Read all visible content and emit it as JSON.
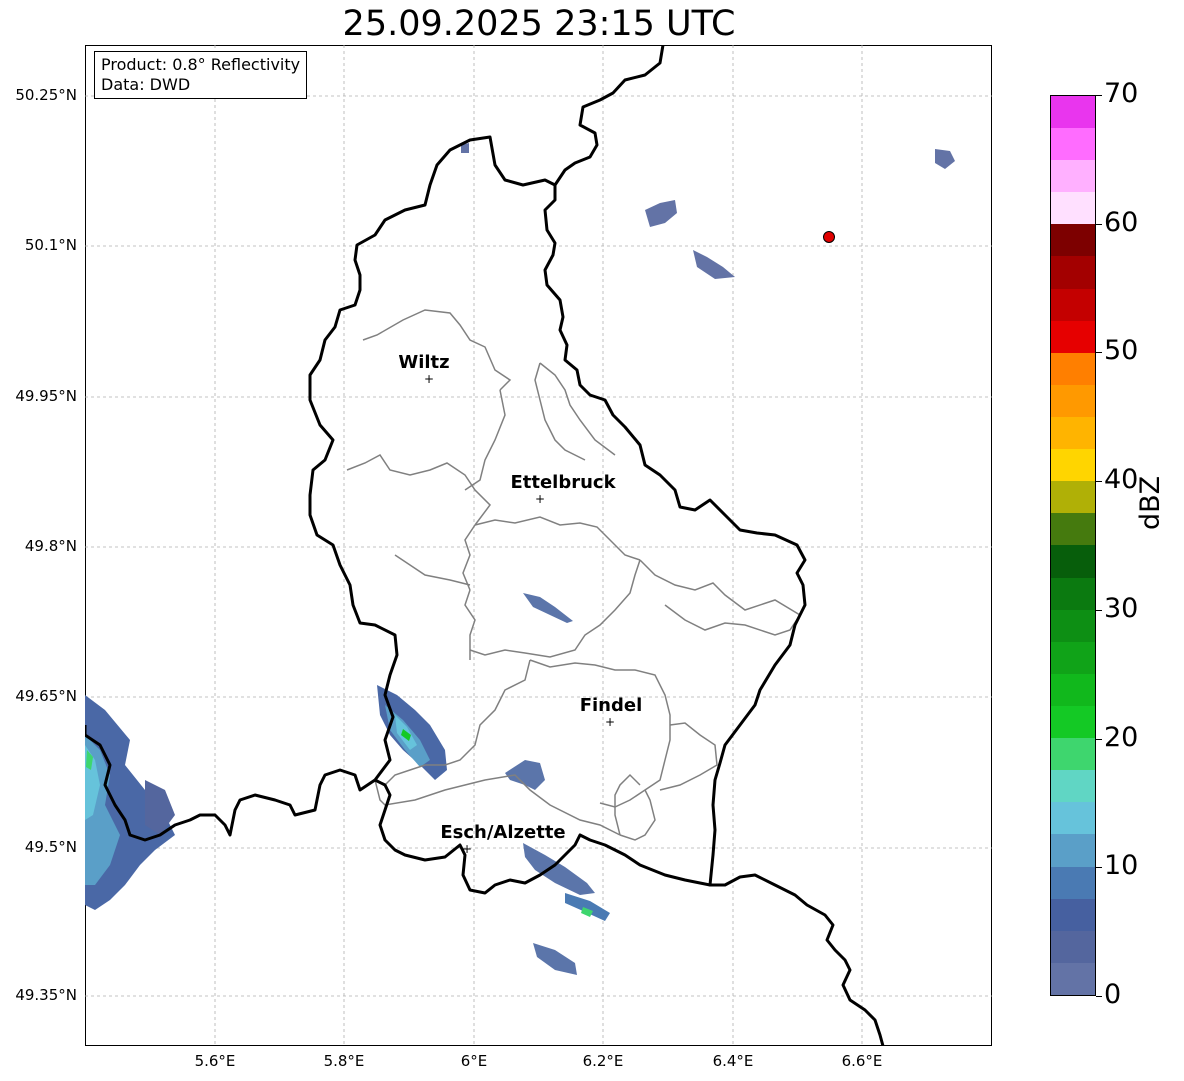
{
  "title": "25.09.2025 23:15 UTC",
  "info": {
    "product": "Product: 0.8° Reflectivity",
    "source": "Data: DWD"
  },
  "axes": {
    "lon_ticks": [
      "5.6°E",
      "5.8°E",
      "6°E",
      "6.2°E",
      "6.4°E",
      "6.6°E"
    ],
    "lat_ticks": [
      "50.25°N",
      "50.1°N",
      "49.95°N",
      "49.8°N",
      "49.65°N",
      "49.5°N",
      "49.35°N"
    ]
  },
  "cities": [
    {
      "name": "Wiltz",
      "lon": 5.93,
      "lat": 49.97
    },
    {
      "name": "Ettelbruck",
      "lon": 6.1,
      "lat": 49.85
    },
    {
      "name": "Findel",
      "lon": 6.21,
      "lat": 49.63
    },
    {
      "name": "Esch/Alzette",
      "lon": 5.99,
      "lat": 49.5
    }
  ],
  "radar_site": {
    "lon": 6.55,
    "lat": 50.11,
    "color": "#e00000"
  },
  "colorbar": {
    "label": "dBZ",
    "min": 0,
    "max": 70,
    "step": 2.5,
    "tick_labels": [
      "0",
      "10",
      "20",
      "30",
      "40",
      "50",
      "60",
      "70"
    ],
    "colors": [
      "#6373a6",
      "#54669e",
      "#4660a0",
      "#4a7ab3",
      "#5a9fc8",
      "#66c3db",
      "#60d6c4",
      "#3ed66e",
      "#14c925",
      "#11b81c",
      "#10a318",
      "#0d8f14",
      "#0b7a10",
      "#075e0b",
      "#457a0e",
      "#b0b006",
      "#ffd500",
      "#ffb400",
      "#ff9900",
      "#ff7f00",
      "#e60000",
      "#c40000",
      "#a30000",
      "#7d0000",
      "#ffe0ff",
      "#ffb0ff",
      "#ff6cff",
      "#e935ee"
    ]
  }
}
